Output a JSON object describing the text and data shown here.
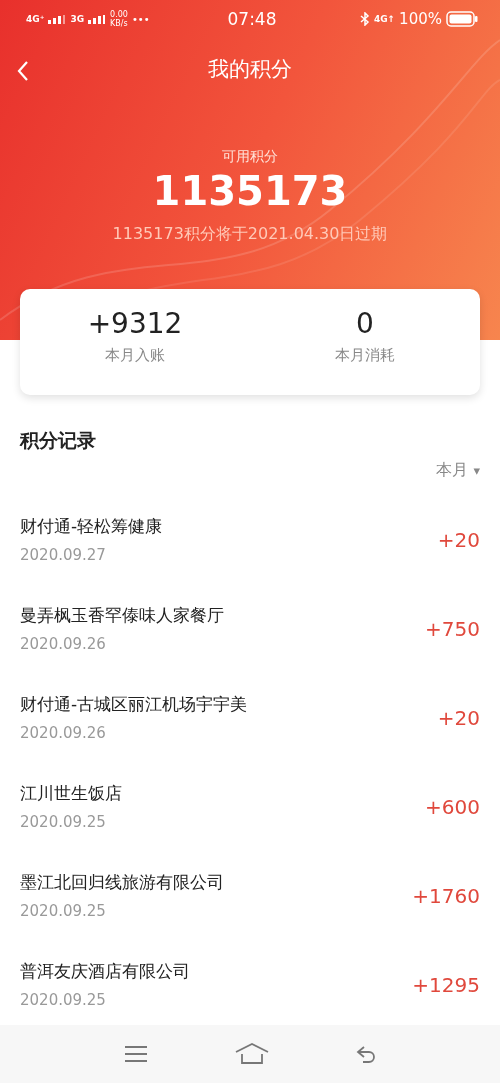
{
  "status_bar": {
    "net1": "4G⁺",
    "net2": "3G",
    "speed": "0.00",
    "speed_unit": "KB/s",
    "dots": "•••",
    "time": "07:48",
    "net3": "4G↑",
    "battery": "100%"
  },
  "header": {
    "title": "我的积分"
  },
  "balance": {
    "label": "可用积分",
    "value": "1135173",
    "expiry": "1135173积分将于2021.04.30日过期"
  },
  "summary": [
    {
      "value": "+9312",
      "label": "本月入账"
    },
    {
      "value": "0",
      "label": "本月消耗"
    }
  ],
  "records": {
    "title": "积分记录",
    "filter": "本月",
    "filter_caret": "▾",
    "items": [
      {
        "name": "财付通-轻松筹健康",
        "date": "2020.09.27",
        "points": "+20"
      },
      {
        "name": "曼弄枫玉香罕傣味人家餐厅",
        "date": "2020.09.26",
        "points": "+750"
      },
      {
        "name": "财付通-古城区丽江机场宇宇美",
        "date": "2020.09.26",
        "points": "+20"
      },
      {
        "name": "江川世生饭店",
        "date": "2020.09.25",
        "points": "+600"
      },
      {
        "name": "墨江北回归线旅游有限公司",
        "date": "2020.09.25",
        "points": "+1760"
      },
      {
        "name": "普洱友庆酒店有限公司",
        "date": "2020.09.25",
        "points": "+1295"
      }
    ]
  }
}
